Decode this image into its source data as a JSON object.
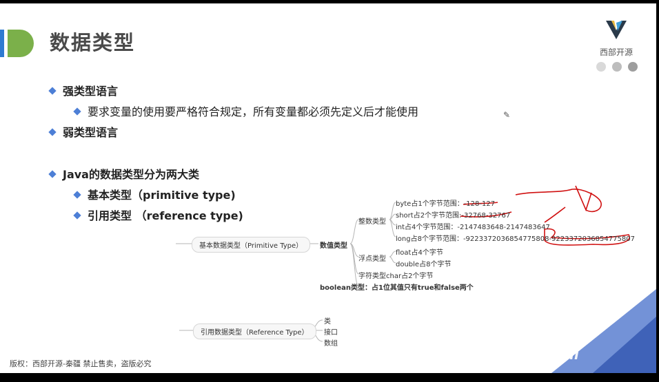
{
  "slide": {
    "title": "数据类型",
    "logo_text": "西部开源",
    "bullets": [
      {
        "text": "强类型语言"
      },
      {
        "text": "要求变量的使用要严格符合规定，所有变量都必须先定义后才能使用"
      },
      {
        "text": "弱类型语言"
      },
      {
        "text": "Java的数据类型分为两大类"
      },
      {
        "text": "基本类型（primitive type)"
      },
      {
        "text": "引用类型  （reference type)"
      }
    ],
    "mindmap": {
      "primitive_root": "基本数据类型（Primitive Type）",
      "numeric": "数值类型",
      "integer": "整数类型",
      "byte": "byte占1个字节范围：-128-127",
      "short": "short占2个字节范围:-32768-32767",
      "int": "int占4个字节范围：-2147483648-2147483647",
      "long": "long占8个字节范围：-9223372036854775808-9223372036854775807",
      "float_cat": "浮点类型",
      "float": "float占4个字节",
      "double": "double占8个字节",
      "char": "字符类型char占2个字节",
      "boolean": "boolean类型：占1位其值只有true和false两个",
      "reference_root": "引用数据类型（Reference Type）",
      "class": "类",
      "interface": "接口",
      "array": "数组"
    },
    "footer": "版权：西部开源-秦疆   禁止售卖，盗版必究",
    "watermark": "bilibili",
    "colors": {
      "accent_blue": "#4d7fd6",
      "accent_green": "#7bb04a",
      "annotation_red": "#d01010"
    }
  }
}
